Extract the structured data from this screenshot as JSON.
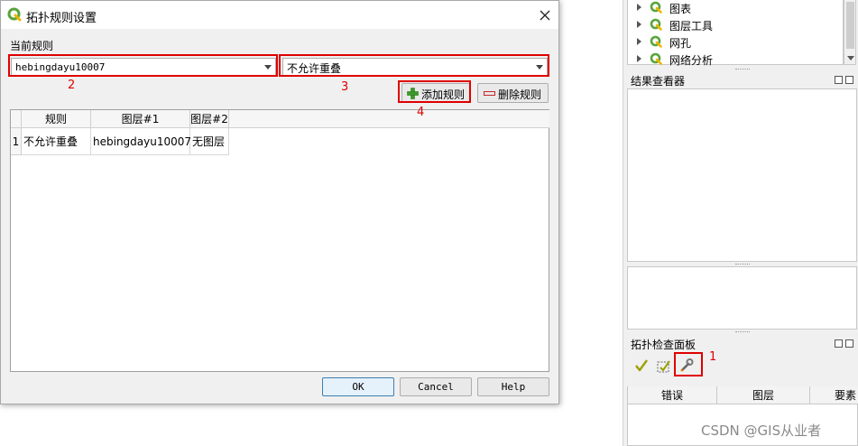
{
  "dialog": {
    "title": "拓扑规则设置",
    "section_label": "当前规则",
    "layer_combo_value": "hebingdayu10007",
    "rule_combo_value": "不允许重叠",
    "add_rule_label": "添加规则",
    "delete_rule_label": "删除规则",
    "table": {
      "headers": [
        "规则",
        "图层#1",
        "图层#2"
      ],
      "rows": [
        {
          "num": "1",
          "rule": "不允许重叠",
          "layer1": "hebingdayu10007",
          "layer2": "无图层"
        }
      ]
    },
    "ok_label": "OK",
    "cancel_label": "Cancel",
    "help_label": "Help"
  },
  "annotations": [
    "1",
    "2",
    "3",
    "4"
  ],
  "processing_tree": {
    "items": [
      {
        "label": "图表",
        "icon": "qgis-q-icon"
      },
      {
        "label": "图层工具",
        "icon": "qgis-q-icon"
      },
      {
        "label": "网孔",
        "icon": "qgis-q-icon"
      },
      {
        "label": "网络分析",
        "icon": "qgis-q-icon"
      }
    ]
  },
  "results_viewer": {
    "title": "结果查看器"
  },
  "topology_panel": {
    "title": "拓扑检查面板",
    "columns": [
      "错误",
      "图层",
      "要素"
    ]
  },
  "watermark": "CSDN @GIS从业者",
  "colors": {
    "annotation_red": "#e00000",
    "qgis_green": "#58a53b",
    "add_green": "#3a9a2a"
  }
}
